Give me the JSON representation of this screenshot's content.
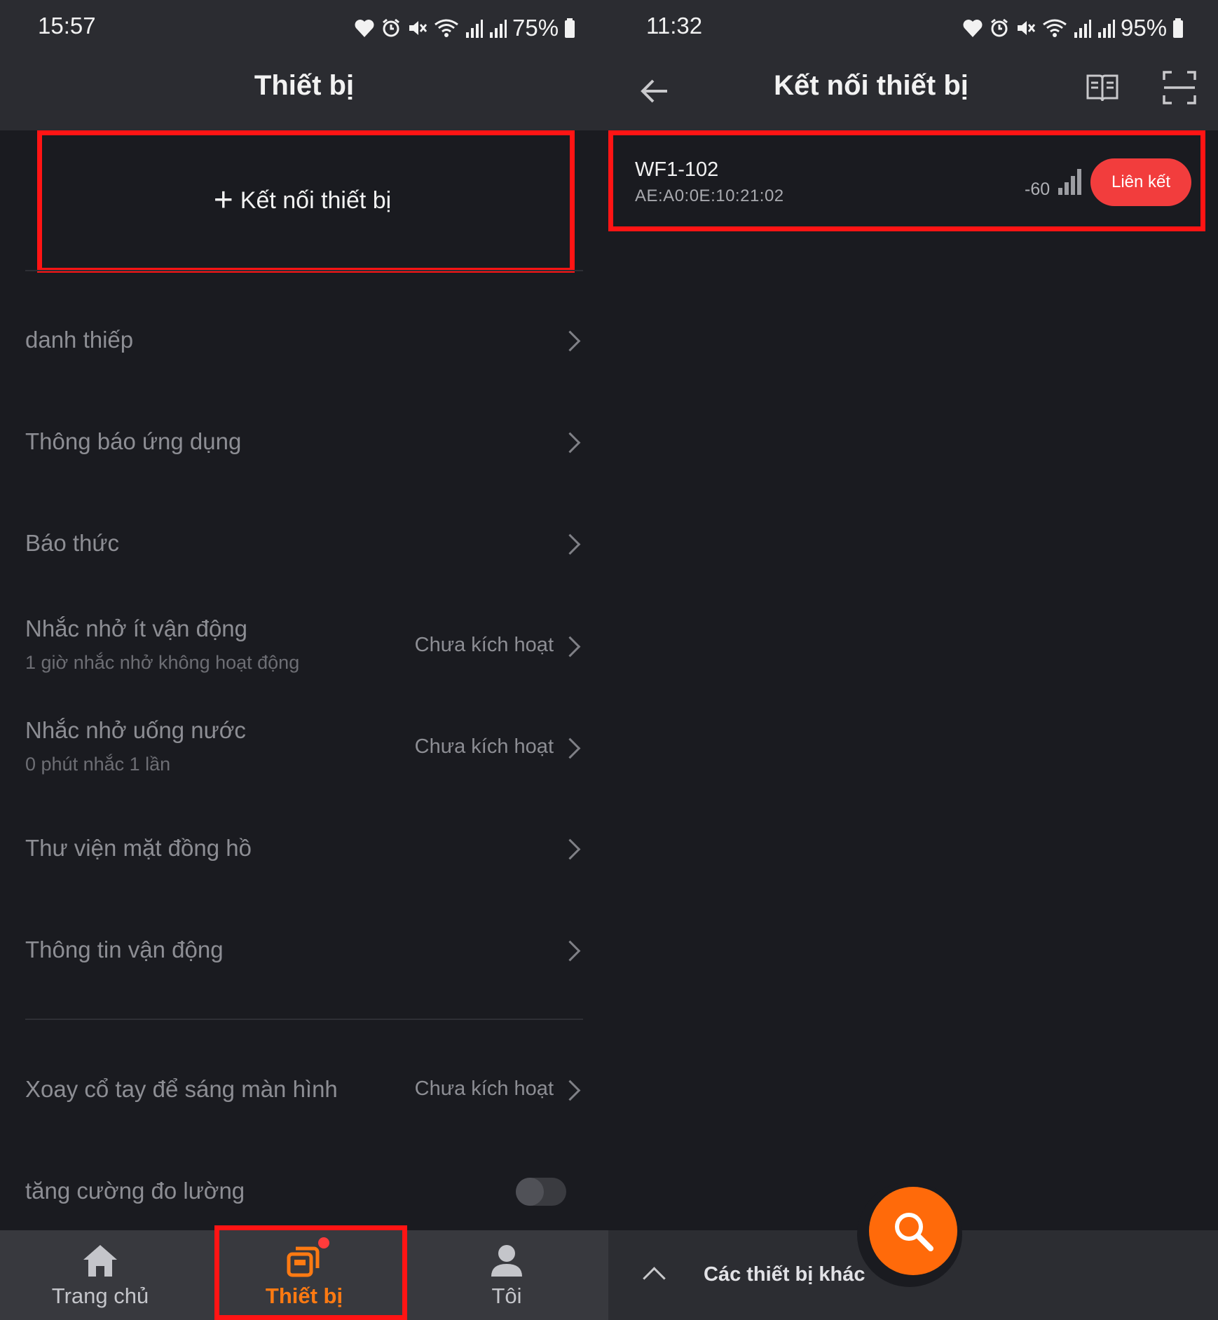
{
  "left": {
    "status": {
      "time": "15:57",
      "battery": "75%"
    },
    "title": "Thiết bị",
    "connect_label": "Kết nối thiết bị",
    "menu": [
      {
        "title": "danh thiếp"
      },
      {
        "title": "Thông báo ứng dụng"
      },
      {
        "title": "Báo thức"
      },
      {
        "title": "Nhắc nhở ít vận động",
        "subtitle": "1 giờ nhắc nhở không hoạt động",
        "status": "Chưa kích hoạt"
      },
      {
        "title": "Nhắc nhở uống nước",
        "subtitle": "0 phút nhắc 1 lần",
        "status": "Chưa kích hoạt"
      },
      {
        "title": "Thư viện mặt đồng hồ"
      },
      {
        "title": "Thông tin vận động"
      },
      {
        "title": "Xoay cổ tay để sáng màn hình",
        "status": "Chưa kích hoạt"
      },
      {
        "title": "tăng cường đo lường",
        "toggle": false
      }
    ],
    "nav": [
      {
        "label": "Trang chủ",
        "icon": "home-icon",
        "active": false
      },
      {
        "label": "Thiết bị",
        "icon": "device-icon",
        "active": true
      },
      {
        "label": "Tôi",
        "icon": "user-icon",
        "active": false
      }
    ]
  },
  "right": {
    "status": {
      "time": "11:32",
      "battery": "95%"
    },
    "title": "Kết nối thiết bị",
    "device": {
      "name": "WF1-102",
      "mac": "AE:A0:0E:10:21:02",
      "rssi": "-60",
      "link_label": "Liên kết"
    },
    "other_devices_label": "Các thiết bị khác"
  },
  "colors": {
    "highlight": "#ff1414",
    "accent": "#ff7a12",
    "link_button": "#f23d3d",
    "background": "#1a1b20",
    "bar": "#2b2c31"
  }
}
